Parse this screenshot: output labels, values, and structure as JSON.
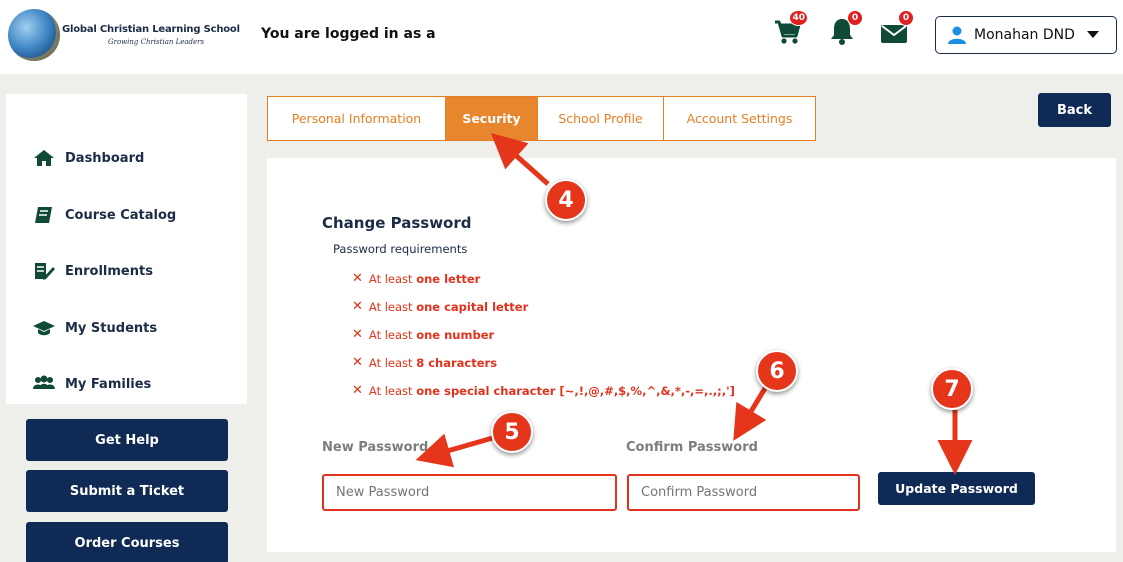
{
  "header": {
    "school_name": "Global Christian Learning School",
    "school_tagline": "Growing Christian Leaders",
    "logged_in_text": "You are logged in as a",
    "cart_count": "40",
    "notifications_count": "0",
    "messages_count": "0",
    "user_name": "Monahan DND"
  },
  "sidebar": {
    "items": [
      {
        "label": "Dashboard",
        "icon": "home-icon"
      },
      {
        "label": "Course Catalog",
        "icon": "book-icon"
      },
      {
        "label": "Enrollments",
        "icon": "edit-icon"
      },
      {
        "label": "My Students",
        "icon": "graduation-cap-icon"
      },
      {
        "label": "My Families",
        "icon": "users-icon"
      }
    ],
    "buttons": [
      "Get Help",
      "Submit a Ticket",
      "Order Courses"
    ]
  },
  "tabs": [
    {
      "label": "Personal Information",
      "active": false
    },
    {
      "label": "Security",
      "active": true
    },
    {
      "label": "School Profile",
      "active": false
    },
    {
      "label": "Account Settings",
      "active": false
    }
  ],
  "back_label": "Back",
  "change_password": {
    "title": "Change Password",
    "requirements_heading": "Password requirements",
    "requirements": [
      {
        "prefix": "At least ",
        "strong": "one letter"
      },
      {
        "prefix": "At least ",
        "strong": "one capital letter"
      },
      {
        "prefix": "At least ",
        "strong": "one number"
      },
      {
        "prefix": "At least ",
        "strong": "8 characters"
      },
      {
        "prefix": "At least ",
        "strong": "one special character [~,!,@,#,$,%,^,&,*,-,=,.,;,']"
      }
    ],
    "new_password_label": "New Password",
    "new_password_placeholder": "New Password",
    "confirm_password_label": "Confirm Password",
    "confirm_password_placeholder": "Confirm Password",
    "update_label": "Update Password"
  },
  "callouts": [
    "4",
    "5",
    "6",
    "7"
  ],
  "colors": {
    "accent": "#e8862e",
    "navy": "#0f2a54",
    "error": "#e0321c",
    "callout": "#e5361c",
    "page_bg": "#eeeeea"
  }
}
